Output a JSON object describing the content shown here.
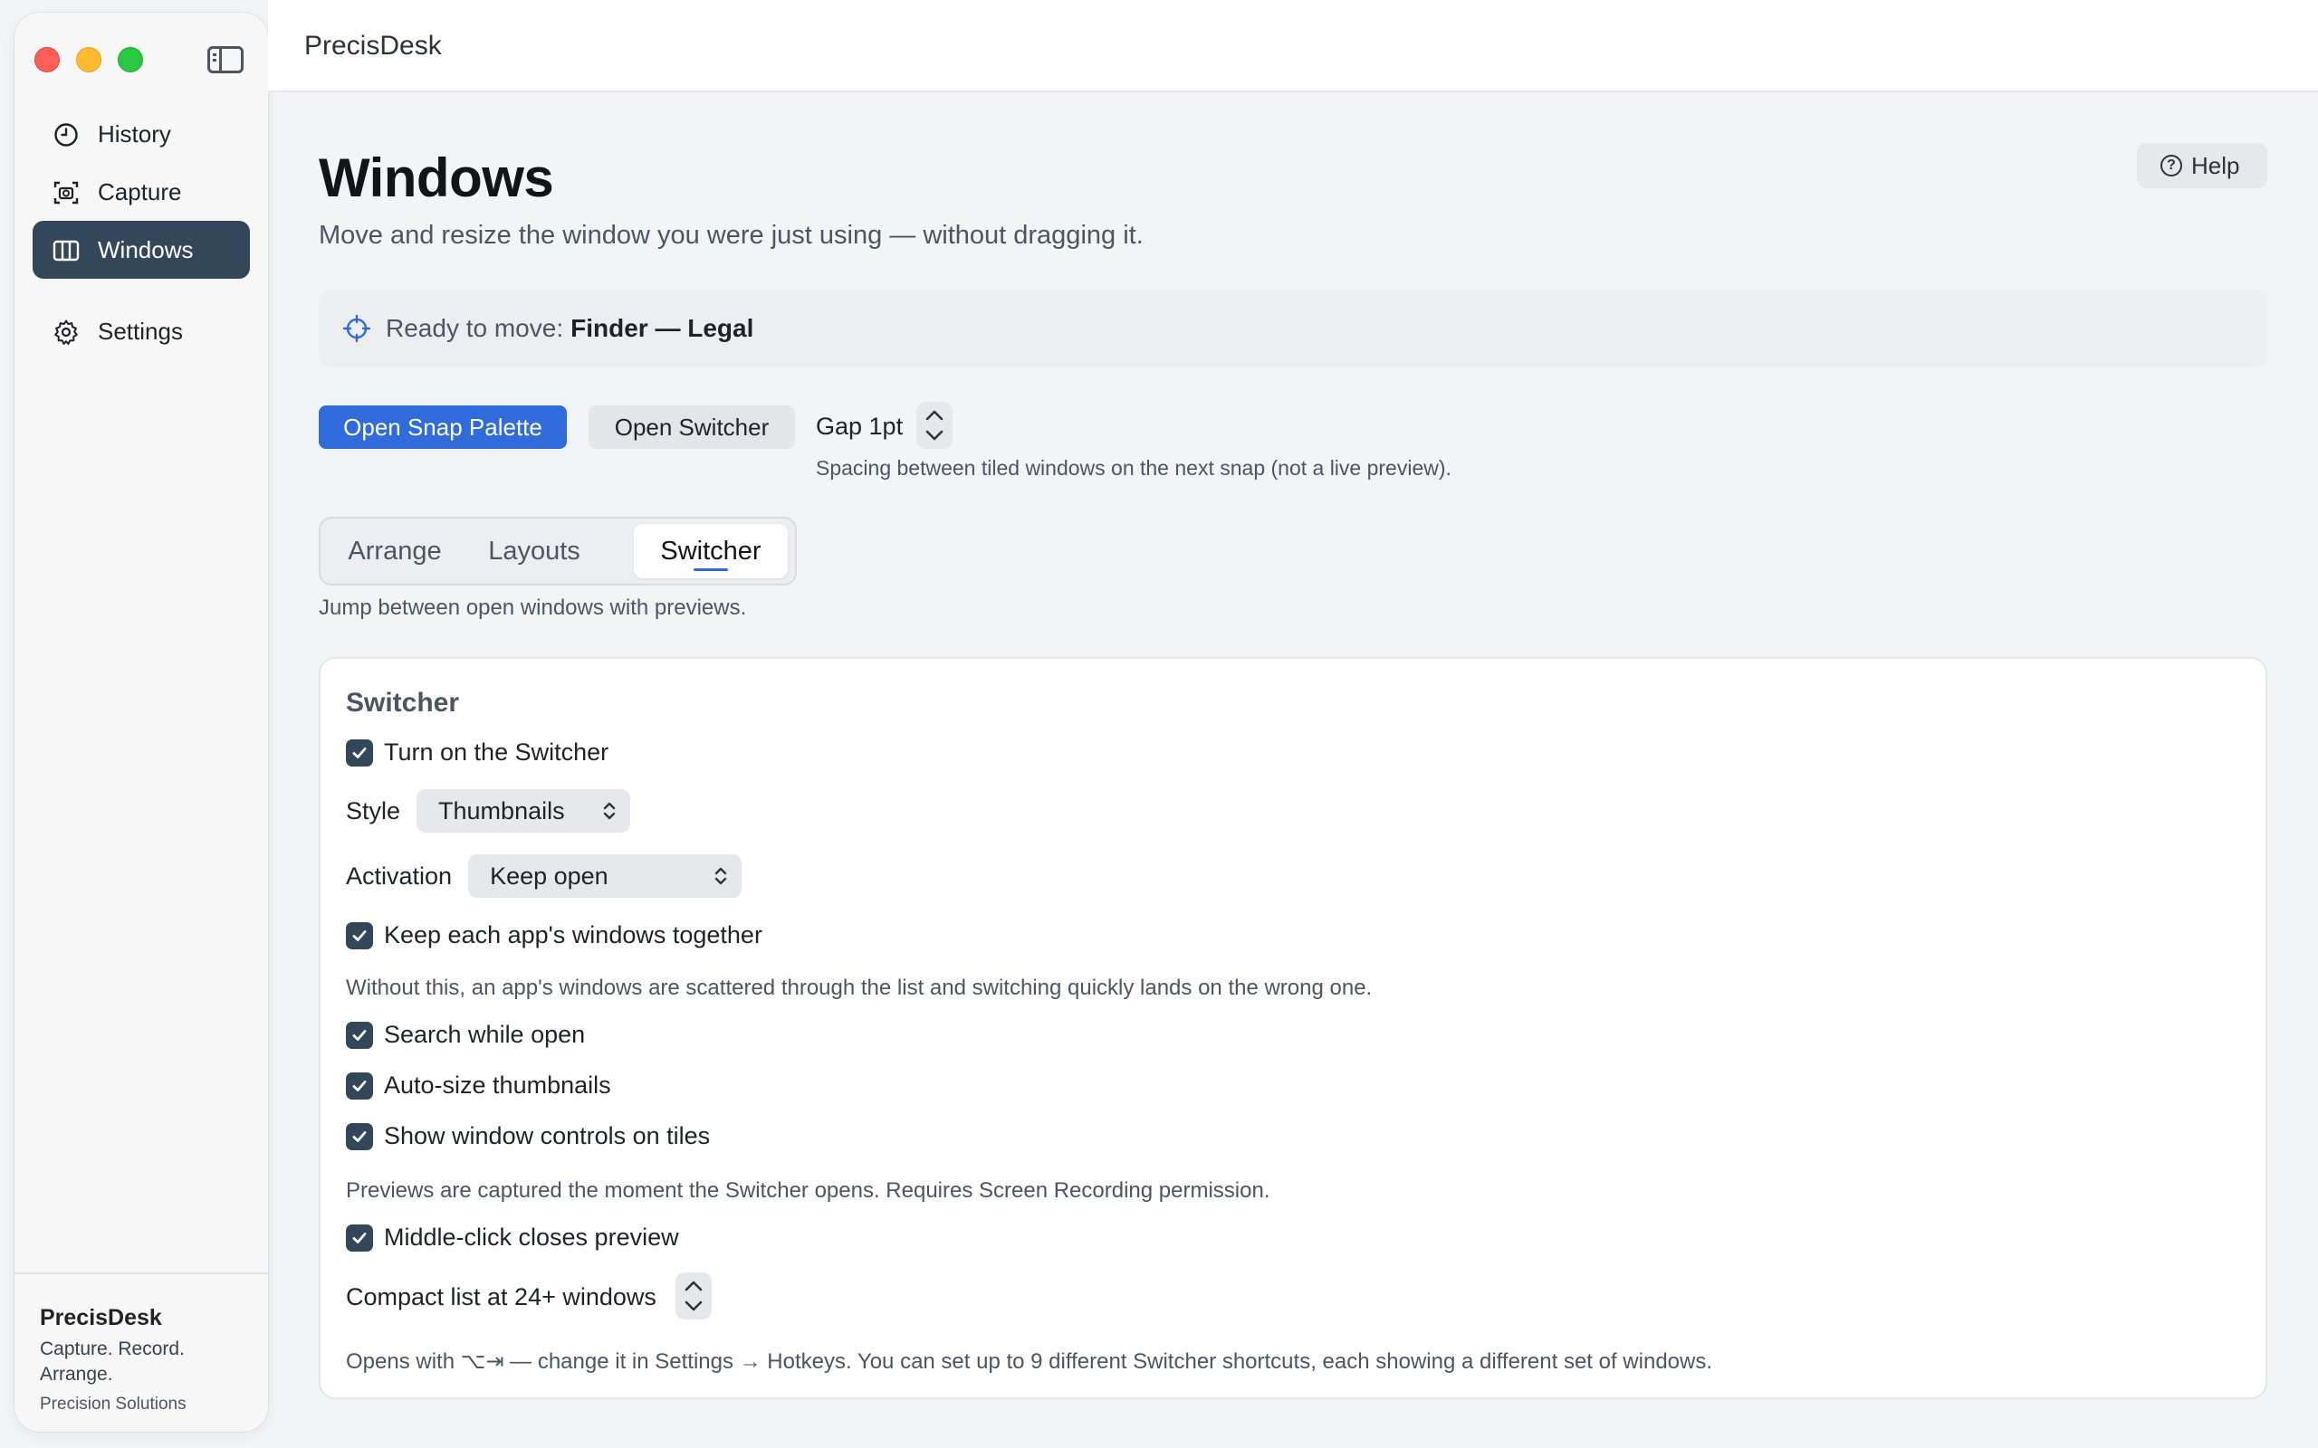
{
  "app": {
    "title": "PrecisDesk"
  },
  "sidebar": {
    "items": [
      {
        "label": "History",
        "icon": "clock-icon"
      },
      {
        "label": "Capture",
        "icon": "camera-icon"
      },
      {
        "label": "Windows",
        "icon": "columns-icon",
        "active": true
      },
      {
        "label": "Settings",
        "icon": "gear-icon"
      }
    ],
    "footer": {
      "brand": "PrecisDesk",
      "tagline": "Capture. Record. Arrange.",
      "company": "Precision Solutions"
    }
  },
  "page": {
    "title": "Windows",
    "subtitle": "Move and resize the window you were just using — without dragging it.",
    "help_label": "Help"
  },
  "status": {
    "prefix": "Ready to move:",
    "target": "Finder — Legal"
  },
  "toolbar": {
    "open_snap_palette": "Open Snap Palette",
    "open_switcher": "Open Switcher",
    "gap_label": "Gap 1pt",
    "gap_hint": "Spacing between tiled windows on the next snap (not a live preview)."
  },
  "tabs": {
    "items": [
      "Arrange",
      "Layouts",
      "Switcher"
    ],
    "selected": "Switcher",
    "description": "Jump between open windows with previews."
  },
  "switcher": {
    "title": "Switcher",
    "turn_on": {
      "label": "Turn on the Switcher",
      "checked": true
    },
    "style": {
      "label": "Style",
      "value": "Thumbnails"
    },
    "activation": {
      "label": "Activation",
      "value": "Keep open"
    },
    "keep_together": {
      "label": "Keep each app's windows together",
      "checked": true
    },
    "keep_together_hint": "Without this, an app's windows are scattered through the list and switching quickly lands on the wrong one.",
    "search_while_open": {
      "label": "Search while open",
      "checked": true
    },
    "auto_size": {
      "label": "Auto-size thumbnails",
      "checked": true
    },
    "show_controls": {
      "label": "Show window controls on tiles",
      "checked": true
    },
    "previews_hint": "Previews are captured the moment the Switcher opens. Requires Screen Recording permission.",
    "middle_click": {
      "label": "Middle-click closes preview",
      "checked": true
    },
    "compact_list": {
      "label": "Compact list at 24+ windows"
    },
    "footer_hint": "Opens with ⌥⇥ — change it in Settings → Hotkeys. You can set up to 9 different Switcher shortcuts, each showing a different set of windows."
  },
  "colors": {
    "accent": "#2f6bdb",
    "sidebar_active": "#33475b",
    "checkbox": "#33475b"
  }
}
